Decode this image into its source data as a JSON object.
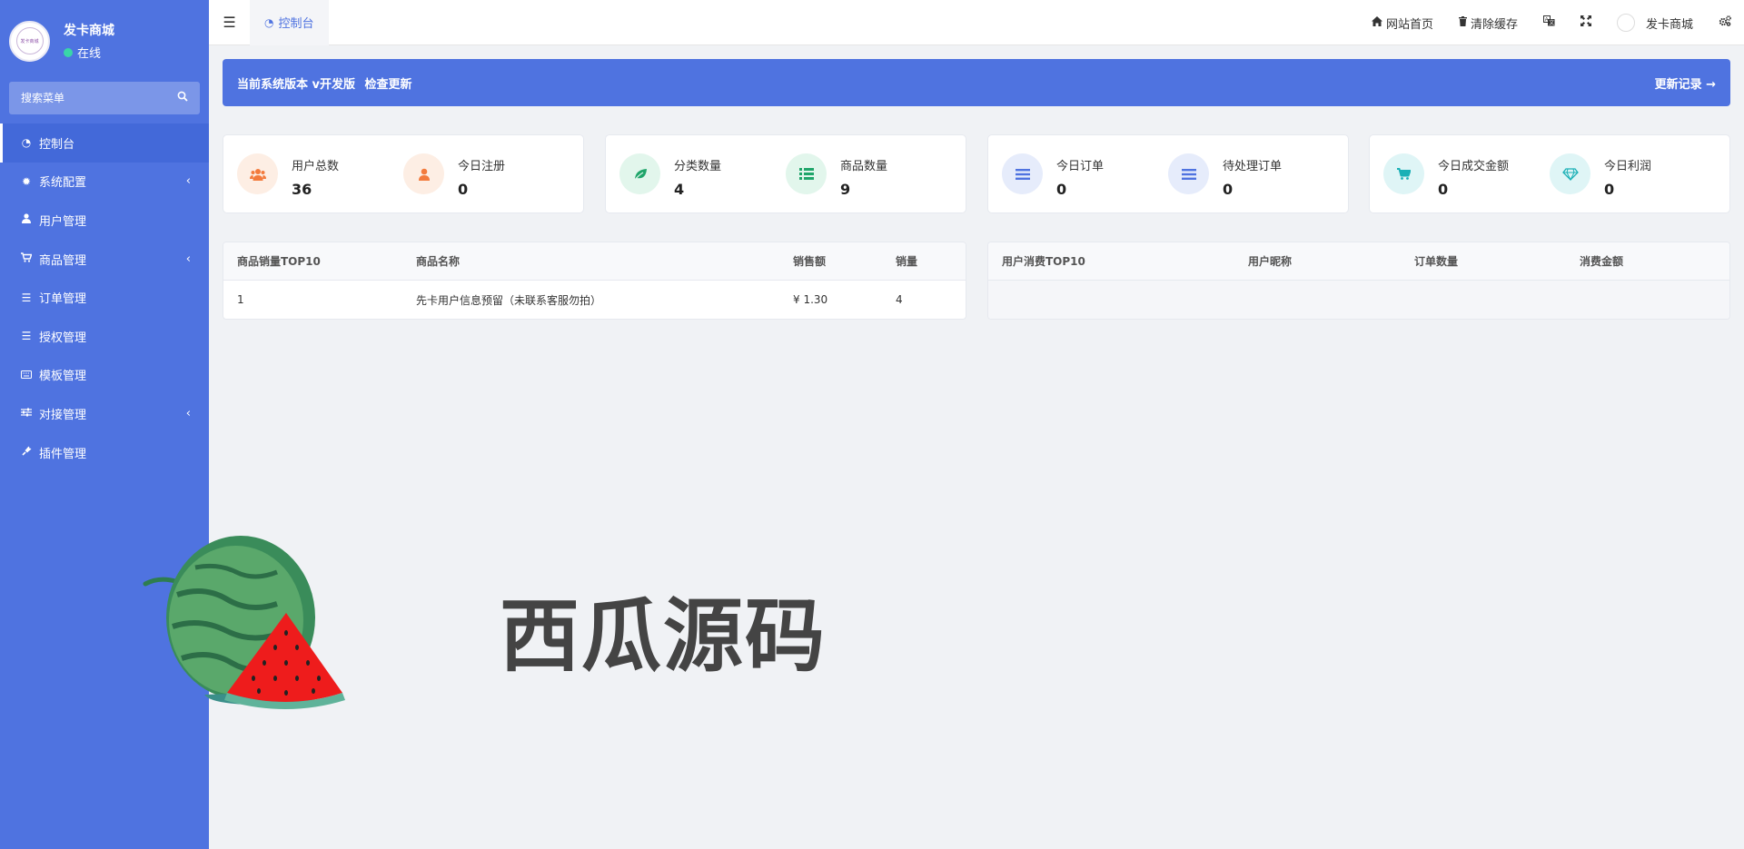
{
  "sidebar": {
    "profile": {
      "name": "发卡商城",
      "status": "在线",
      "avatar_text": "发卡商城"
    },
    "search": {
      "placeholder": "搜索菜单"
    },
    "items": [
      {
        "label": "控制台",
        "icon": "dashboard-icon",
        "active": true
      },
      {
        "label": "系统配置",
        "icon": "gear-icon",
        "submenu": true
      },
      {
        "label": "用户管理",
        "icon": "user-icon"
      },
      {
        "label": "商品管理",
        "icon": "cart-icon",
        "submenu": true
      },
      {
        "label": "订单管理",
        "icon": "list-icon"
      },
      {
        "label": "授权管理",
        "icon": "list-icon"
      },
      {
        "label": "模板管理",
        "icon": "keyboard-icon"
      },
      {
        "label": "对接管理",
        "icon": "sliders-icon",
        "submenu": true
      },
      {
        "label": "插件管理",
        "icon": "plug-icon"
      }
    ]
  },
  "topbar": {
    "tab_label": "控制台",
    "home_link": "网站首页",
    "clear_cache": "清除缓存",
    "user_name": "发卡商城"
  },
  "banner": {
    "version_text": "当前系统版本 v开发版",
    "check_update": "检查更新",
    "changelog": "更新记录 →"
  },
  "stats": [
    {
      "label": "用户总数",
      "value": "36",
      "icon": "users-icon",
      "color": "#f37b3d",
      "bg": "#fdeee4"
    },
    {
      "label": "今日注册",
      "value": "0",
      "icon": "user-icon",
      "color": "#f37b3d",
      "bg": "#fdeee4"
    },
    {
      "label": "分类数量",
      "value": "4",
      "icon": "leaf-icon",
      "color": "#1fa56a",
      "bg": "#e2f6ec"
    },
    {
      "label": "商品数量",
      "value": "9",
      "icon": "list-icon",
      "color": "#1fa56a",
      "bg": "#e2f6ec"
    },
    {
      "label": "今日订单",
      "value": "0",
      "icon": "list-icon",
      "color": "#4f73e0",
      "bg": "#e6ecfb"
    },
    {
      "label": "待处理订单",
      "value": "0",
      "icon": "list-icon",
      "color": "#4f73e0",
      "bg": "#e6ecfb"
    },
    {
      "label": "今日成交金额",
      "value": "0",
      "icon": "cart-icon",
      "color": "#1ab0b6",
      "bg": "#dff5f6"
    },
    {
      "label": "今日利润",
      "value": "0",
      "icon": "diamond-icon",
      "color": "#1ab0b6",
      "bg": "#dff5f6"
    }
  ],
  "sales_table": {
    "headers": [
      "商品销量TOP10",
      "商品名称",
      "销售额",
      "销量"
    ],
    "rows": [
      [
        "1",
        "先卡用户信息预留（未联系客服勿拍）",
        "¥ 1.30",
        "4"
      ]
    ]
  },
  "consume_table": {
    "headers": [
      "用户消费TOP10",
      "用户昵称",
      "订单数量",
      "消费金额"
    ],
    "rows": []
  },
  "watermark": {
    "text": "西瓜源码"
  }
}
